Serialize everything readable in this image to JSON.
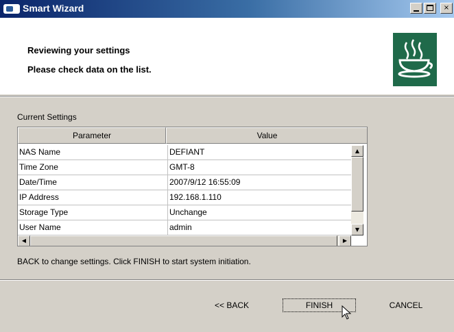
{
  "window": {
    "title": "Smart Wizard",
    "controls": {
      "minimize_icon": "minimize-icon",
      "maximize_icon": "maximize-icon",
      "close_label": "×"
    }
  },
  "header": {
    "heading": "Reviewing your settings",
    "subheading": "Please check data on the list.",
    "logo_icon": "teacup-steam-logo",
    "logo_color": "#1f6a4a"
  },
  "settings": {
    "group_label": "Current Settings",
    "columns": [
      "Parameter",
      "Value"
    ],
    "rows": [
      {
        "parameter": "NAS Name",
        "value": "DEFIANT"
      },
      {
        "parameter": "Time Zone",
        "value": "GMT-8"
      },
      {
        "parameter": "Date/Time",
        "value": "2007/9/12 16:55:09"
      },
      {
        "parameter": "IP Address",
        "value": "192.168.1.110"
      },
      {
        "parameter": "Storage Type",
        "value": "Unchange"
      },
      {
        "parameter": "User Name",
        "value": "admin"
      }
    ],
    "scroll_icons": {
      "up": "▲",
      "down": "▼",
      "left": "◀",
      "right": "▶"
    }
  },
  "instruction": "BACK to change settings. Click FINISH to start system initiation.",
  "buttons": {
    "back": "<< BACK",
    "finish": "FINISH",
    "cancel": "CANCEL"
  }
}
